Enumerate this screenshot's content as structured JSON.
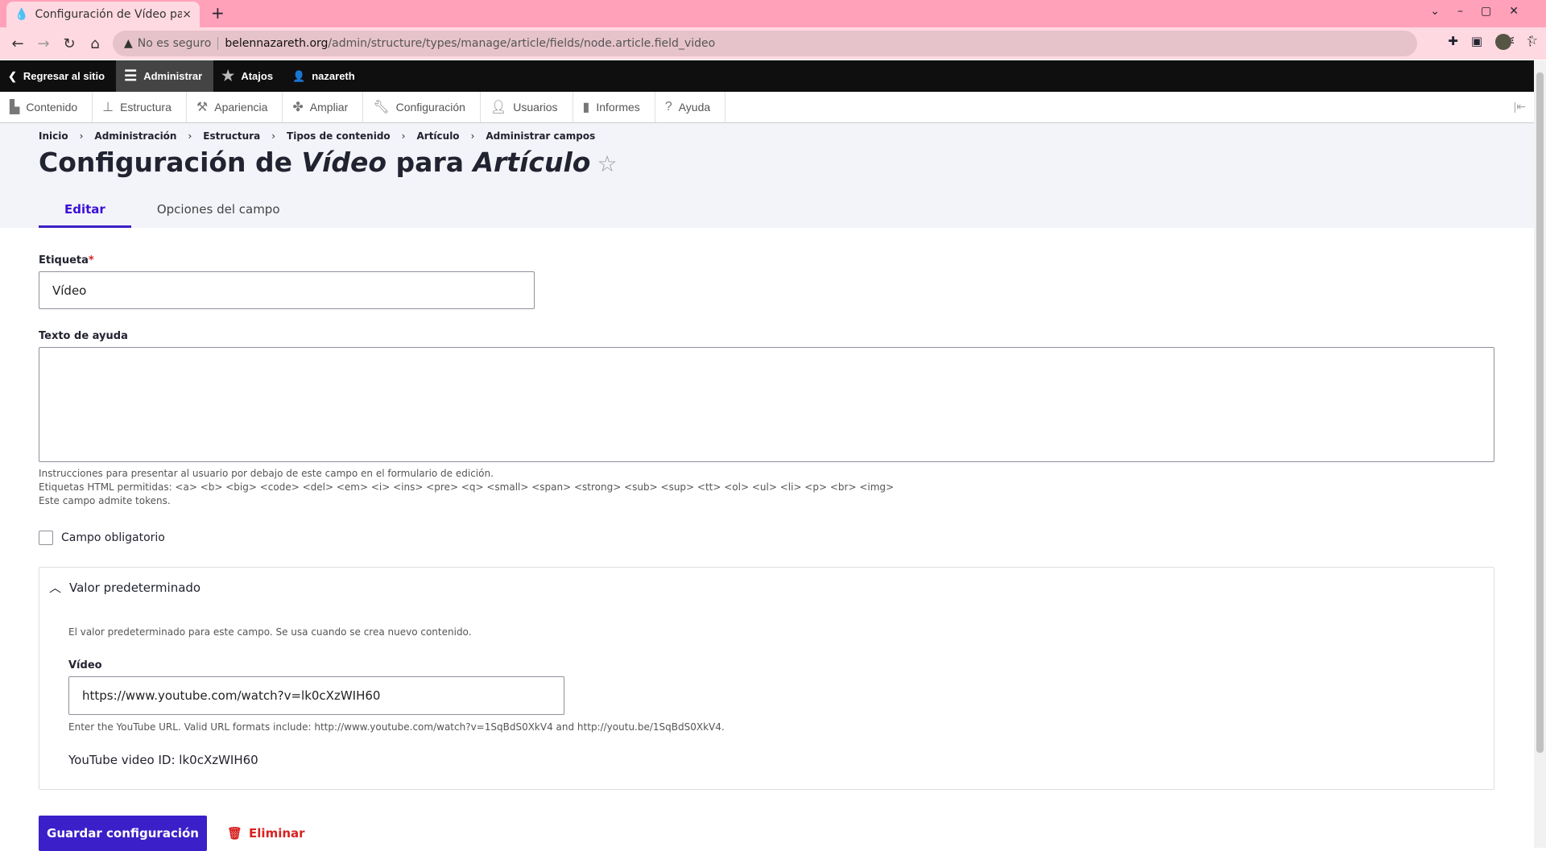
{
  "browser": {
    "tab_title": "Configuración de Vídeo para Artículo",
    "new_tab": "+",
    "close": "×",
    "not_secure": "No es seguro",
    "url_domain": "belennazareth.org",
    "url_path": "/admin/structure/types/manage/article/fields/node.article.field_video"
  },
  "toolbar": {
    "back": "Regresar al sitio",
    "admin": "Administrar",
    "shortcuts": "Atajos",
    "user": "nazareth"
  },
  "tray": [
    "Contenido",
    "Estructura",
    "Apariencia",
    "Ampliar",
    "Configuración",
    "Usuarios",
    "Informes",
    "Ayuda"
  ],
  "breadcrumb": [
    "Inicio",
    "Administración",
    "Estructura",
    "Tipos de contenido",
    "Artículo",
    "Administrar campos"
  ],
  "title": {
    "prefix": "Configuración de ",
    "field": "Vídeo",
    "mid": " para ",
    "type": "Artículo"
  },
  "tabs": {
    "edit": "Editar",
    "options": "Opciones del campo"
  },
  "form": {
    "label_label": "Etiqueta",
    "label_value": "Vídeo",
    "required_mark": "*",
    "help_label": "Texto de ayuda",
    "help_value": "",
    "help_desc1": "Instrucciones para presentar al usuario por debajo de este campo en el formulario de edición.",
    "help_desc2": "Etiquetas HTML permitidas: <a> <b> <big> <code> <del> <em> <i> <ins> <pre> <q> <small> <span> <strong> <sub> <sup> <tt> <ol> <ul> <li> <p> <br> <img>",
    "help_desc3": "Este campo admite tokens.",
    "required_checkbox": "Campo obligatorio",
    "required_checked": false
  },
  "default": {
    "summary": "Valor predeterminado",
    "desc": "El valor predeterminado para este campo. Se usa cuando se crea nuevo contenido.",
    "video_label": "Vídeo",
    "video_value": "https://www.youtube.com/watch?v=lk0cXzWIH60",
    "video_help": "Enter the YouTube URL. Valid URL formats include: http://www.youtube.com/watch?v=1SqBdS0XkV4 and http://youtu.be/1SqBdS0XkV4.",
    "video_id": "YouTube video ID: lk0cXzWIH60"
  },
  "actions": {
    "save": "Guardar configuración",
    "delete": "Eliminar"
  }
}
